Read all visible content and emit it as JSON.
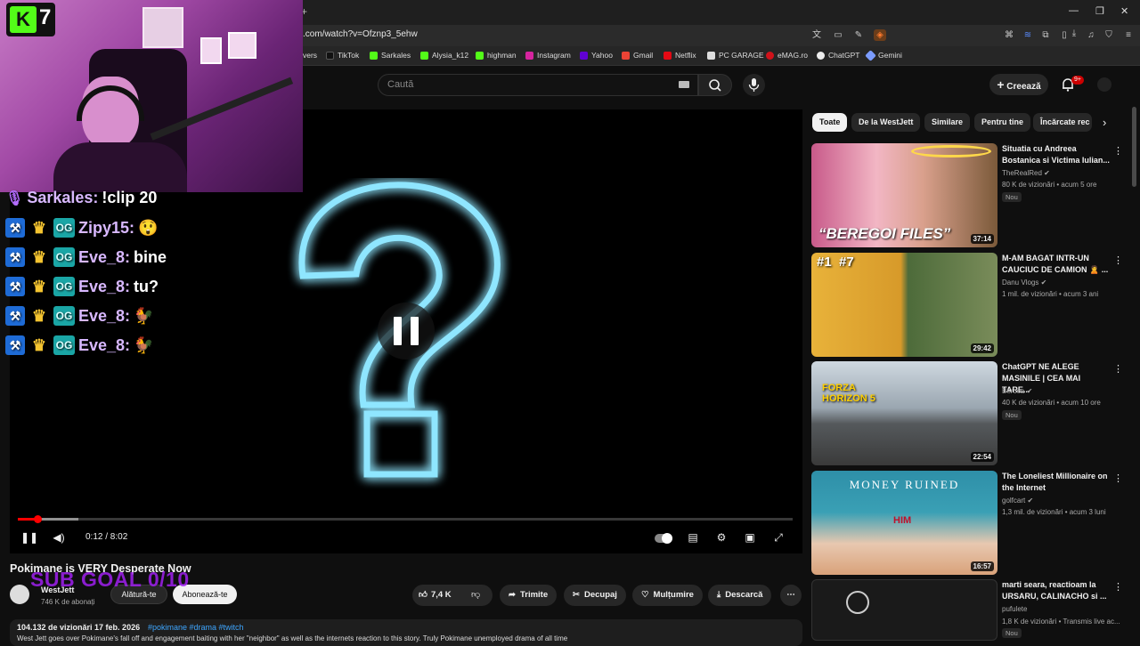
{
  "browser": {
    "url": ".com/watch?v=Ofznp3_5ehw",
    "new_tab": "+",
    "bookmarks": [
      "vers",
      "TikTok",
      "Sarkales",
      "Alysia_k12",
      "highman",
      "Instagram",
      "Yahoo",
      "Gmail",
      "Netflix",
      "PC GARAGE",
      "eMAG.ro",
      "ChatGPT",
      "Gemini"
    ]
  },
  "header": {
    "search_placeholder": "Caută",
    "create_label": "Creează",
    "notif_count": "9+"
  },
  "player": {
    "time": "0:12 / 8:02",
    "progress_fraction": 0.025
  },
  "video": {
    "title": "Pokimane is VERY Desperate Now",
    "channel": "WestJett",
    "subscribers": "746 K de abonați",
    "join_label": "Alătură-te",
    "subscribe_label": "Abonează-te",
    "likes": "7,4 K",
    "share_label": "Trimite",
    "clip_label": "Decupaj",
    "thanks_label": "Mulțumire",
    "download_label": "Descarcă",
    "views_date": "104.132 de vizionări  17 feb. 2026",
    "hashtags": "#pokimane #drama #twitch",
    "description": "West Jett goes over Pokimane's fall off and engagement baiting with her \"neighbor\" as well as the internets reaction to this story. Truly Pokimane unemployed drama of all time"
  },
  "chips": [
    "Toate",
    "De la WestJett",
    "Similare",
    "Pentru tine",
    "Încărcate rec"
  ],
  "recommended": [
    {
      "title": "Situatia cu Andreea Bostanica si Victima Iulian...",
      "channel": "TheRealRed",
      "stats": "80 K de vizionări • acum 5 ore",
      "badge": "Nou",
      "duration": "37:14",
      "thumb_text": "“BEREGOI FILES”"
    },
    {
      "title": "M-AM BAGAT INTR-UN CAUCIUC DE CAMION 🙎 ...",
      "channel": "Danu Vlogs",
      "stats": "1 mil. de vizionări • acum 3 ani",
      "badge": "",
      "duration": "29:42",
      "thumb_text": "#1  #7"
    },
    {
      "title": "ChatGPT NE ALEGE MASINILE | CEA MAI TARE...",
      "channel": "Bercea",
      "stats": "40 K de vizionări • acum 10 ore",
      "badge": "Nou",
      "duration": "22:54",
      "thumb_text": "FORZA HORIZON 5"
    },
    {
      "title": "The Loneliest Millionaire on the Internet",
      "channel": "golfcart",
      "stats": "1,3 mil. de vizionări • acum 3 luni",
      "badge": "",
      "duration": "16:57",
      "thumb_text": "MONEY RUINED",
      "thumb_sub": "HIM"
    },
    {
      "title": "marti seara, reactioam la URSARU, CALINACHO si ...",
      "channel": "pufulete",
      "stats": "1,8 K de vizionări • Transmis live ac...",
      "badge": "Nou",
      "duration": "",
      "thumb_text": ""
    }
  ],
  "overlay": {
    "logo": "7",
    "chat": [
      {
        "user": "Sarkales:",
        "msg": "!clip 20"
      },
      {
        "user": "Zipy15:",
        "msg": "😲"
      },
      {
        "user": "Eve_8:",
        "msg": "bine"
      },
      {
        "user": "Eve_8:",
        "msg": "tu?"
      },
      {
        "user": "Eve_8:",
        "msg": "🐓"
      },
      {
        "user": "Eve_8:",
        "msg": "🐓"
      }
    ],
    "sub_goal": "SUB GOAL 0/10"
  }
}
